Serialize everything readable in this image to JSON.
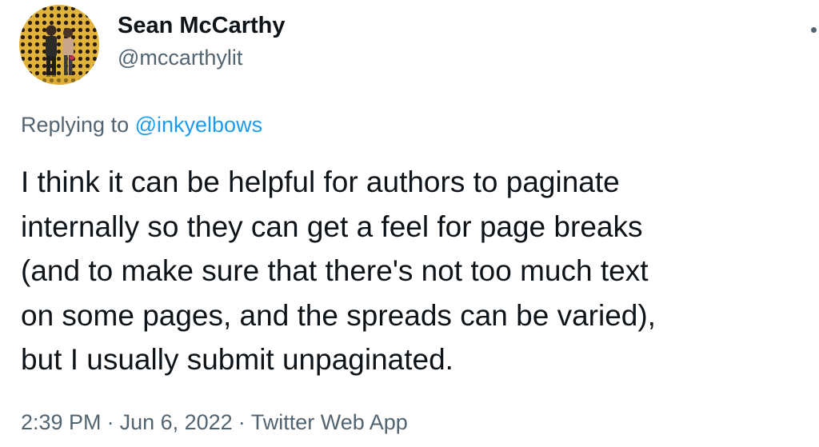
{
  "author": {
    "display_name": "Sean McCarthy",
    "handle": "@mccarthylit"
  },
  "reply": {
    "prefix": "Replying to ",
    "to_handle": "@inkyelbows"
  },
  "tweet": {
    "lines": [
      "I think it can be helpful for authors to paginate",
      "internally so they can get a feel for page breaks",
      "(and to make sure that there's not too much text",
      "on some pages, and the spreads can be varied),",
      "but I usually submit unpaginated."
    ]
  },
  "meta": {
    "time": "2:39 PM",
    "separator": "·",
    "date": "Jun 6, 2022",
    "source": "Twitter Web App"
  },
  "icons": {
    "more": "more-options-icon"
  },
  "colors": {
    "text": "#0f1419",
    "secondary": "#536471",
    "link": "#1d9bf0"
  }
}
